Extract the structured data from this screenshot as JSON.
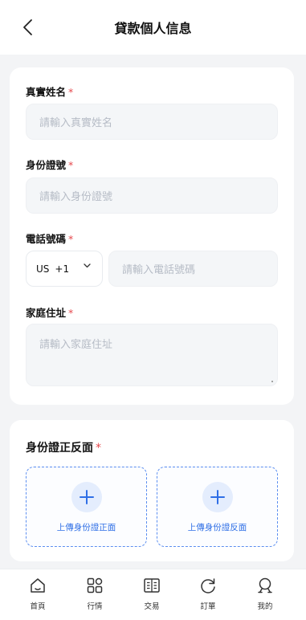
{
  "header": {
    "title": "貸款個人信息",
    "back_icon": "chevron-left-icon"
  },
  "form": {
    "name": {
      "label": "真實姓名",
      "required": "*",
      "placeholder": "請輸入真實姓名"
    },
    "id_number": {
      "label": "身份證號",
      "required": "*",
      "placeholder": "請輸入身份證號"
    },
    "phone": {
      "label": "電話號碼",
      "required": "*",
      "country_code": "US",
      "dial_code": "+1",
      "placeholder": "請輸入電話號碼"
    },
    "address": {
      "label": "家庭住址",
      "required": "*",
      "placeholder": "請輸入家庭住址"
    }
  },
  "id_upload": {
    "title": "身份證正反面",
    "required": "*",
    "front_label": "上傳身份證正面",
    "back_label": "上傳身份證反面"
  },
  "tabbar": {
    "items": [
      {
        "label": "首頁",
        "icon": "home-icon"
      },
      {
        "label": "行情",
        "icon": "grid-icon"
      },
      {
        "label": "交易",
        "icon": "book-icon"
      },
      {
        "label": "訂單",
        "icon": "refresh-icon"
      },
      {
        "label": "我的",
        "icon": "user-icon"
      }
    ]
  },
  "colors": {
    "accent": "#2f6fe6",
    "required": "#e5484d",
    "background": "#f3f4f6",
    "input_bg": "#f4f6f8",
    "placeholder": "#b6bcc6"
  }
}
